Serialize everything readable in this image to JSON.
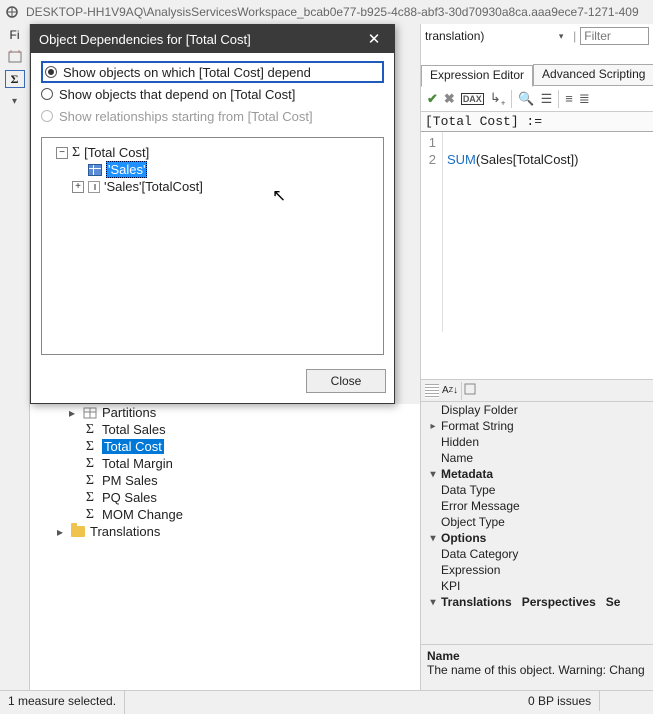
{
  "titlebar": {
    "prefix": "DESKTOP-HH1V9AQ",
    "path": "AnalysisServicesWorkspace_bcab0e77-b925-4c88-abf3-30d70930a8ca.aaa9ece7-1271-409"
  },
  "left_strip": {
    "file_label": "Fi"
  },
  "right_panel": {
    "translation_label": "translation)",
    "filter_placeholder": "Filter",
    "tabs": {
      "expr": "Expression Editor",
      "adv": "Advanced Scripting"
    },
    "toolbar": {
      "dax_badge": "DAX"
    },
    "editor_header": "[Total Cost] :=",
    "gutter": {
      "l1": "1",
      "l2": "2"
    },
    "code": {
      "kw": "SUM",
      "rest": "(Sales[TotalCost])"
    }
  },
  "tree": {
    "partitions": "Partitions",
    "items": [
      "Total Sales",
      "Total Cost",
      "Total Margin",
      "PM Sales",
      "PQ Sales",
      "MOM Change"
    ],
    "translations": "Translations"
  },
  "props": {
    "rows": {
      "display_folder": "Display Folder",
      "format_string": "Format String",
      "hidden": "Hidden",
      "name": "Name",
      "metadata": "Metadata",
      "data_type": "Data Type",
      "error_message": "Error Message",
      "object_type": "Object Type",
      "options": "Options",
      "data_category": "Data Category",
      "expression": "Expression",
      "kpi": "KPI",
      "translations_sec": "Translations   Perspectives   Se"
    },
    "desc": {
      "title": "Name",
      "text": "The name of this object. Warning: Chang"
    }
  },
  "status": {
    "left": "1 measure selected.",
    "right": "0 BP issues"
  },
  "dialog": {
    "title": "Object Dependencies for [Total Cost]",
    "radios": {
      "r1": "Show objects on which [Total Cost] depend",
      "r2": "Show objects that depend on [Total Cost]",
      "r3": "Show relationships starting from [Total Cost]"
    },
    "tree": {
      "root": "[Total Cost]",
      "child1": "'Sales'",
      "child2": "'Sales'[TotalCost]"
    },
    "close_btn": "Close"
  }
}
